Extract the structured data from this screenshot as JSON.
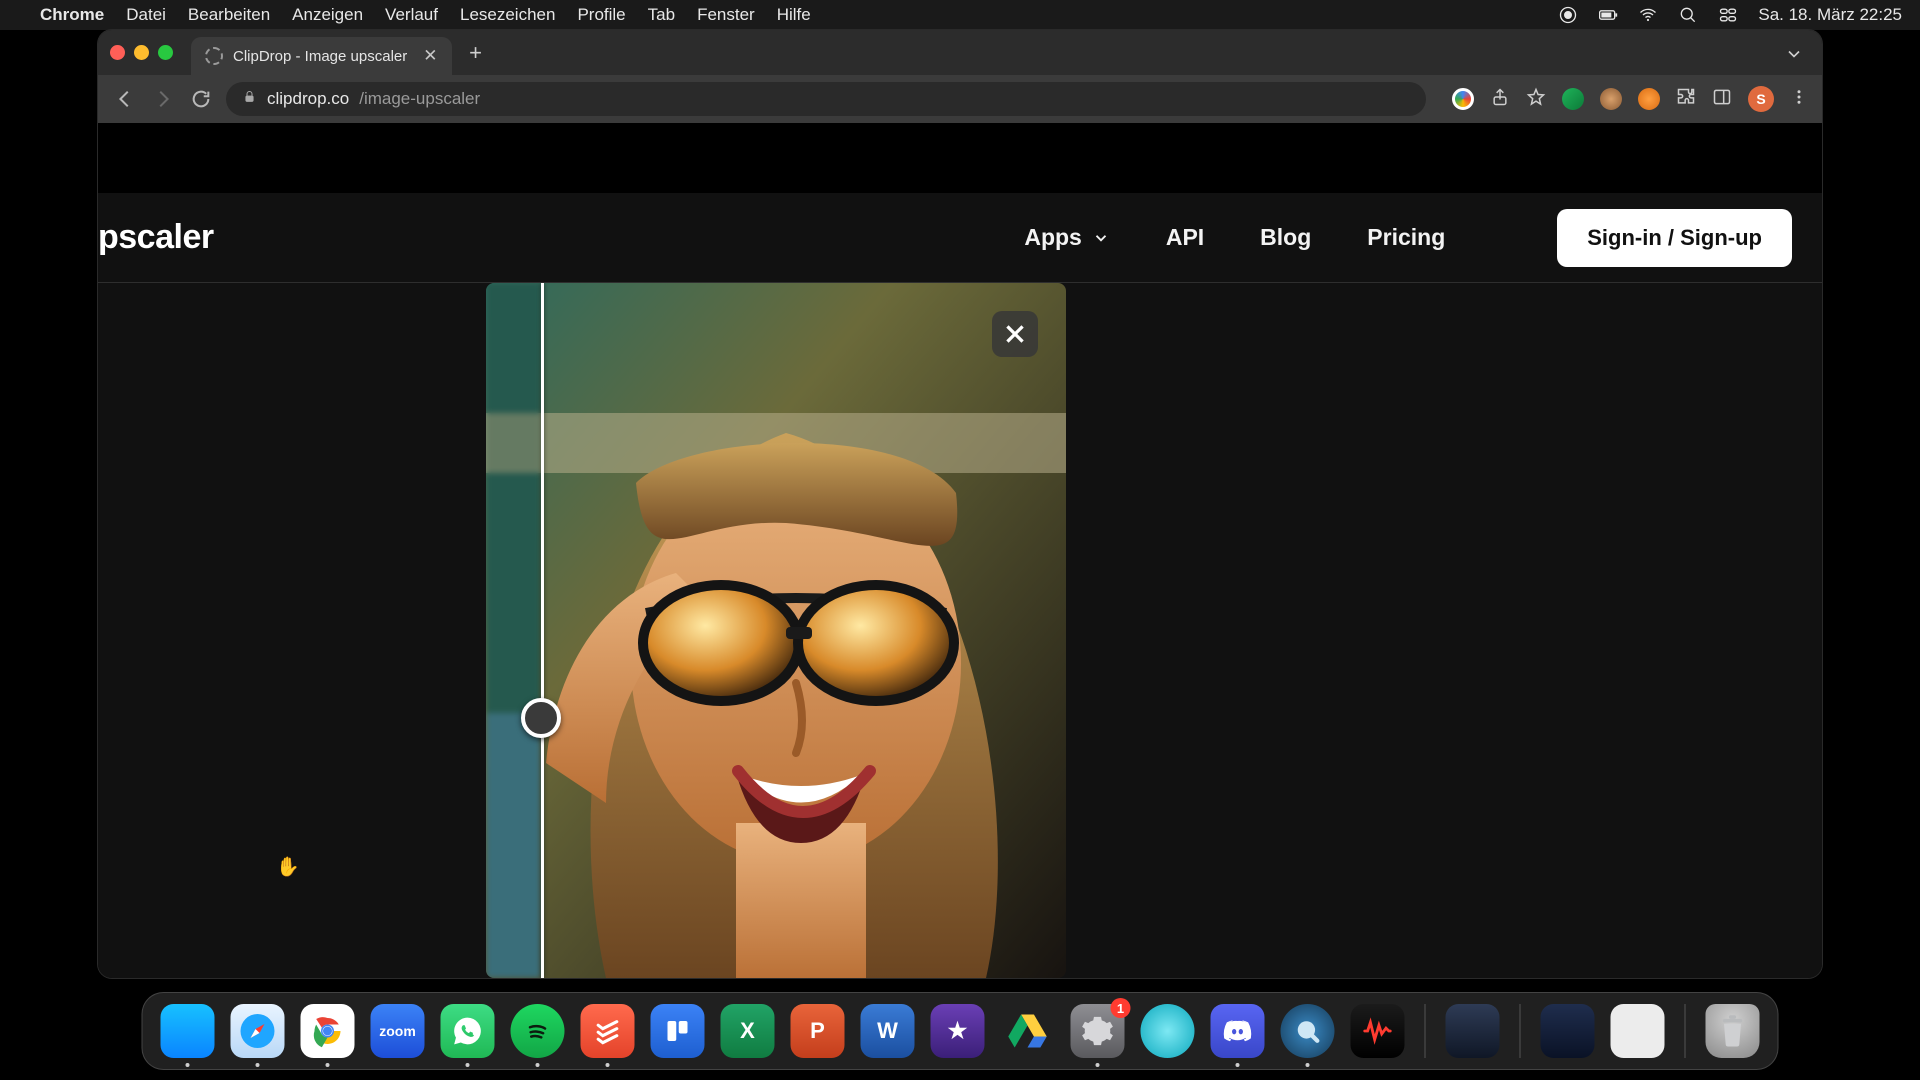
{
  "menubar": {
    "appname": "Chrome",
    "items": [
      "Datei",
      "Bearbeiten",
      "Anzeigen",
      "Verlauf",
      "Lesezeichen",
      "Profile",
      "Tab",
      "Fenster",
      "Hilfe"
    ],
    "clock": "Sa. 18. März  22:25"
  },
  "browser": {
    "tab_title": "ClipDrop - Image upscaler",
    "url_host": "clipdrop.co",
    "url_path": "/image-upscaler",
    "avatar_initial": "S"
  },
  "page": {
    "title_fragment": "pscaler",
    "nav": {
      "apps": "Apps",
      "api": "API",
      "blog": "Blog",
      "pricing": "Pricing"
    },
    "signin": "Sign-in / Sign-up"
  },
  "dock": {
    "badge_settings": "1",
    "icons": [
      {
        "name": "finder",
        "c1": "#17c1ff",
        "c2": "#0a84ff",
        "label": ""
      },
      {
        "name": "safari",
        "c1": "#25b6ff",
        "c2": "#0a60ff",
        "label": ""
      },
      {
        "name": "chrome",
        "c1": "#ffffff",
        "c2": "#e7e7e7",
        "label": ""
      },
      {
        "name": "zoom",
        "c1": "#3b82f6",
        "c2": "#1d4ed8",
        "label": ""
      },
      {
        "name": "whatsapp",
        "c1": "#3ddc84",
        "c2": "#20b955",
        "label": ""
      },
      {
        "name": "spotify",
        "c1": "#1ed760",
        "c2": "#12a646",
        "label": ""
      },
      {
        "name": "todoist",
        "c1": "#ff6a4d",
        "c2": "#e4432a",
        "label": ""
      },
      {
        "name": "trello",
        "c1": "#3b82f6",
        "c2": "#1e5fd0",
        "label": ""
      },
      {
        "name": "excel",
        "c1": "#21a366",
        "c2": "#107c41",
        "label": "X"
      },
      {
        "name": "powerpoint",
        "c1": "#e8643a",
        "c2": "#c43e1c",
        "label": "P"
      },
      {
        "name": "word",
        "c1": "#3a7bd5",
        "c2": "#1b4fa0",
        "label": "W"
      },
      {
        "name": "imovie",
        "c1": "#6a3fb5",
        "c2": "#3b1f78",
        "label": "★"
      },
      {
        "name": "drive",
        "c1": "#ffd04c",
        "c2": "#22a565",
        "label": ""
      },
      {
        "name": "settings",
        "c1": "#8e8e93",
        "c2": "#5a5a5e",
        "label": ""
      },
      {
        "name": "circle-app",
        "c1": "#35d3e6",
        "c2": "#0aa8bd",
        "label": ""
      },
      {
        "name": "discord",
        "c1": "#5865f2",
        "c2": "#3947c9",
        "label": ""
      },
      {
        "name": "quicktime",
        "c1": "#2f6fb3",
        "c2": "#18456f",
        "label": ""
      },
      {
        "name": "voice-memos",
        "c1": "#1b1b1b",
        "c2": "#000000",
        "label": ""
      }
    ]
  }
}
